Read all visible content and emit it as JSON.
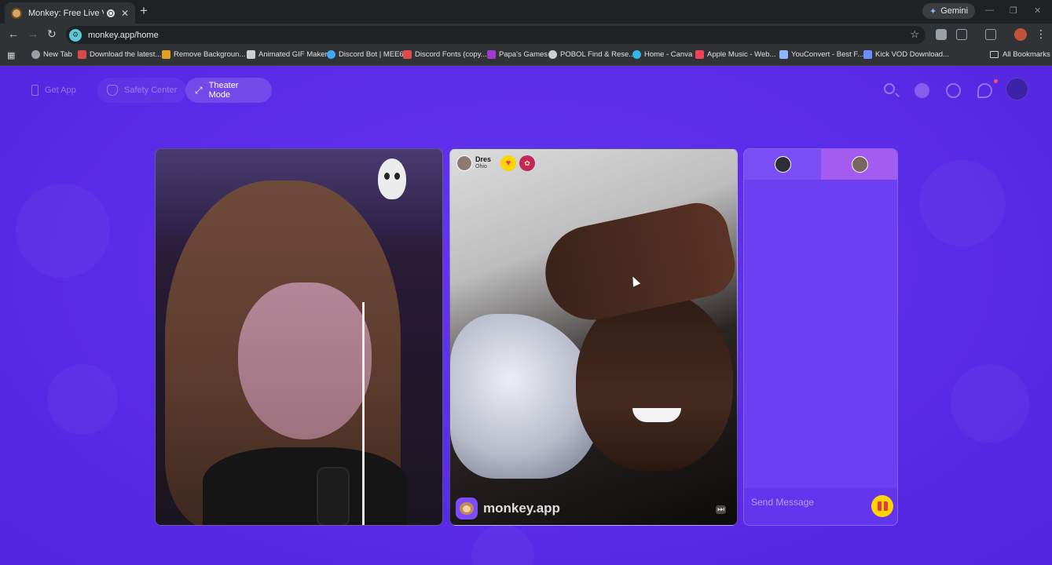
{
  "browser": {
    "tab_title": "Monkey: Free Live Video Ch",
    "new_tab_symbol": "+",
    "tab_close_symbol": "✕",
    "gemini_label": "Gemini",
    "url": "monkey.app/home",
    "window_controls": [
      "—",
      "❐",
      "✕"
    ],
    "bookmarks": [
      {
        "label": "New Tab",
        "icon": "globe-icon",
        "color": "#9aa0a6"
      },
      {
        "label": "Download the latest...",
        "icon": "download-icon",
        "color": "#d94a4a"
      },
      {
        "label": "Remove Backgroun...",
        "icon": "image-icon",
        "color": "#e0a020"
      },
      {
        "label": "Animated GIF Maker",
        "icon": "gif-icon",
        "color": "#cfcfcf"
      },
      {
        "label": "Discord Bot | MEE6",
        "icon": "bot-icon",
        "color": "#3fa9f5"
      },
      {
        "label": "Discord Fonts (copy...",
        "icon": "font-icon",
        "color": "#e04a4a"
      },
      {
        "label": "Papa's Games",
        "icon": "game-icon",
        "color": "#a03ad0"
      },
      {
        "label": "POBOL Find & Rese...",
        "icon": "globe-icon",
        "color": "#cfcfcf"
      },
      {
        "label": "Home - Canva",
        "icon": "canva-icon",
        "color": "#35b5e5"
      },
      {
        "label": "Apple Music - Web...",
        "icon": "music-icon",
        "color": "#f0435a"
      },
      {
        "label": "YouConvert - Best F...",
        "icon": "convert-icon",
        "color": "#8fb4ff"
      },
      {
        "label": "Kick VOD Download...",
        "icon": "kick-icon",
        "color": "#6f8cff"
      }
    ],
    "all_bookmarks_label": "All Bookmarks"
  },
  "header": {
    "get_app_label": "Get App",
    "safety_center_label": "Safety Center",
    "theater_mode_label": "Theater Mode"
  },
  "remote_user": {
    "name": "Dres",
    "location": "Ohio"
  },
  "brand": {
    "text": "monkey.app",
    "skip_symbol": "⏭"
  },
  "chat": {
    "placeholder": "Send Message"
  },
  "colors": {
    "page_background": "#5b2be8",
    "accent_yellow": "#ffd400",
    "chat_panel": "#6a3df2"
  }
}
